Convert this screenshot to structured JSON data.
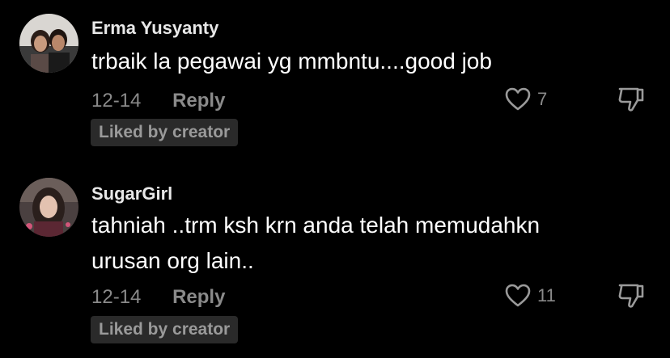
{
  "comments": [
    {
      "username": "Erma Yusyanty",
      "text": "trbaik la pegawai yg mmbntu....good job",
      "date": "12-14",
      "reply_label": "Reply",
      "like_count": "7",
      "badge": "Liked by creator",
      "avatar": "avatar-couple-photo",
      "like_icon": "heart-outline-icon",
      "dislike_icon": "thumbs-down-icon"
    },
    {
      "username": "SugarGirl",
      "text_lines": [
        "tahniah ..trm ksh krn anda telah memudahkn",
        "urusan org lain.."
      ],
      "date": "12-14",
      "reply_label": "Reply",
      "like_count": "11",
      "badge": "Liked by creator",
      "avatar": "avatar-woman-photo",
      "like_icon": "heart-outline-icon",
      "dislike_icon": "thumbs-down-icon"
    }
  ],
  "colors": {
    "background": "#000000",
    "primary_text": "#ffffff",
    "secondary_text": "#8a8a8a",
    "badge_bg": "#2a2a2a"
  }
}
